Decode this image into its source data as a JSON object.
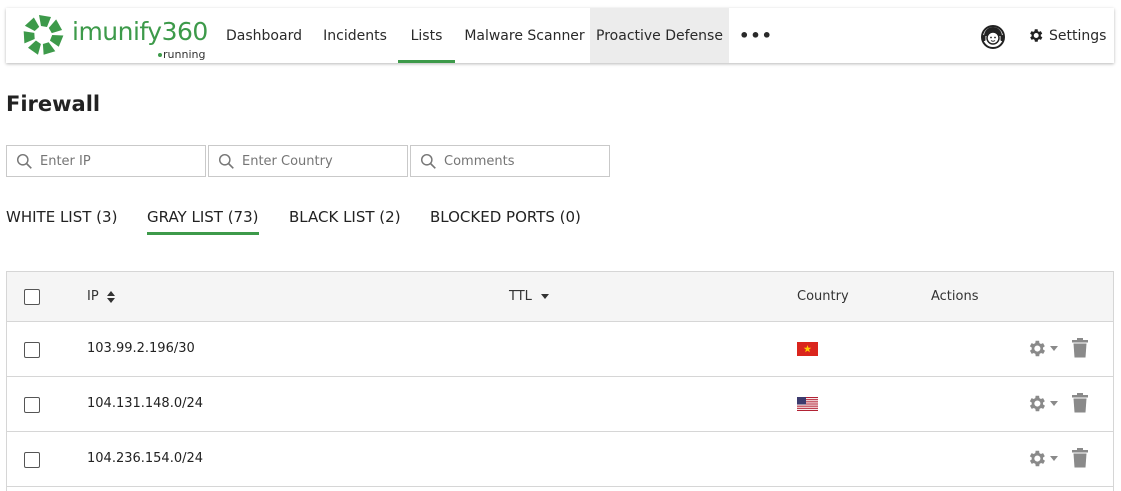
{
  "app": {
    "logo_text": "imunify360",
    "status": "running"
  },
  "nav": {
    "items": [
      {
        "label": "Dashboard"
      },
      {
        "label": "Incidents"
      },
      {
        "label": "Lists"
      },
      {
        "label": "Malware Scanner"
      },
      {
        "label": "Proactive Defense"
      }
    ],
    "more": "•••",
    "settings_label": "Settings",
    "support_icon": "support-headset-icon",
    "settings_icon": "gear-icon"
  },
  "page": {
    "title": "Firewall"
  },
  "filters": {
    "ip_placeholder": "Enter IP",
    "country_placeholder": "Enter Country",
    "comments_placeholder": "Comments"
  },
  "list_tabs": [
    {
      "label": "WHITE LIST (3)"
    },
    {
      "label": "GRAY LIST (73)"
    },
    {
      "label": "BLACK LIST (2)"
    },
    {
      "label": "BLOCKED PORTS (0)"
    }
  ],
  "table": {
    "headers": {
      "ip": "IP",
      "ttl": "TTL",
      "country": "Country",
      "actions": "Actions"
    },
    "rows": [
      {
        "ip": "103.99.2.196/30",
        "country_flag": "vietnam-flag"
      },
      {
        "ip": "104.131.148.0/24",
        "country_flag": "usa-flag"
      },
      {
        "ip": "104.236.154.0/24",
        "country_flag": ""
      }
    ]
  },
  "colors": {
    "brand_green": "#3d9a4a",
    "active_tab_bg": "#ececec",
    "action_icon": "#8a8a8a"
  }
}
